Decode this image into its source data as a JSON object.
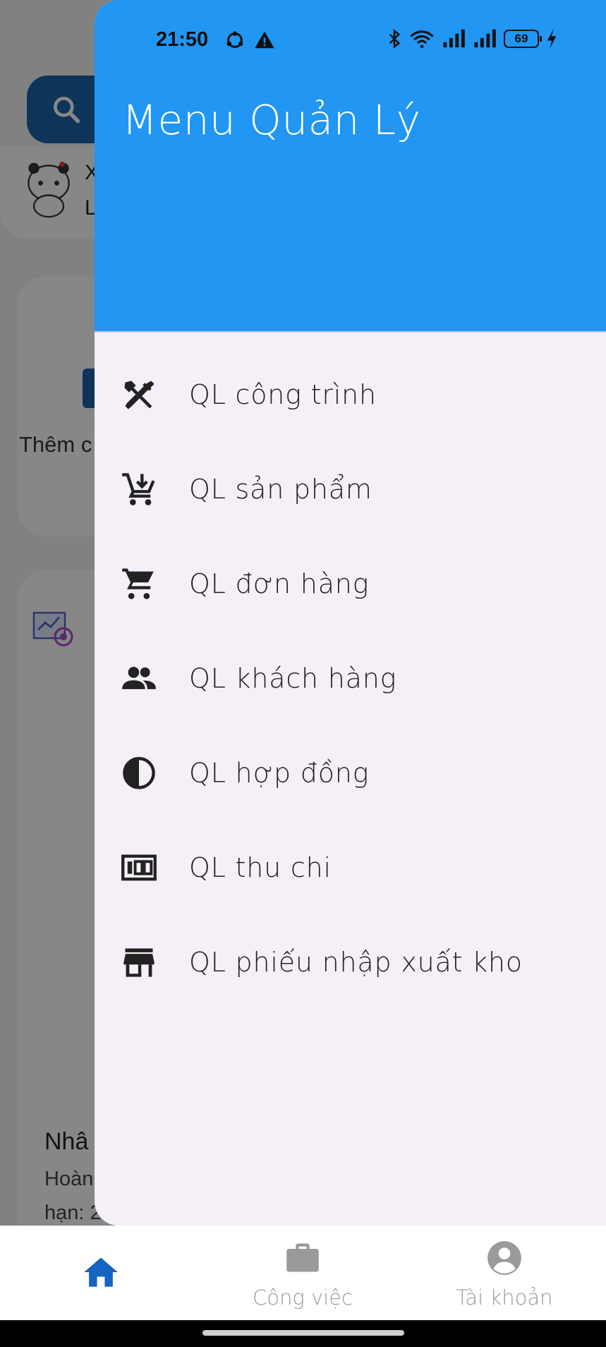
{
  "status_bar": {
    "time": "21:50",
    "battery_level": "69",
    "icons": [
      "sync-icon",
      "warning-icon",
      "bluetooth-icon",
      "wifi-icon",
      "signal-icon",
      "signal-icon",
      "battery-icon",
      "charging-icon"
    ]
  },
  "background": {
    "user_line_1": "X",
    "user_line_2": "L",
    "card1_text": "Thêm c",
    "card2_title": "Nhâ",
    "card2_line1": "Hoàn",
    "card2_line2": "hạn: 2"
  },
  "drawer": {
    "title": "Menu Quản Lý",
    "items": [
      {
        "label": "QL công trình",
        "icon": "tools-icon"
      },
      {
        "label": "QL sản phẩm",
        "icon": "add-shopping-cart-icon"
      },
      {
        "label": "QL đơn hàng",
        "icon": "shopping-cart-icon"
      },
      {
        "label": "QL khách hàng",
        "icon": "people-icon"
      },
      {
        "label": "QL hợp đồng",
        "icon": "contrast-icon"
      },
      {
        "label": "QL thu chi",
        "icon": "money-icon"
      },
      {
        "label": "QL phiếu nhập xuất kho",
        "icon": "store-icon"
      }
    ]
  },
  "bottom_nav": {
    "items": [
      {
        "label": "",
        "icon": "home-icon",
        "active": true
      },
      {
        "label": "Công việc",
        "icon": "briefcase-icon",
        "active": false
      },
      {
        "label": "Tài khoản",
        "icon": "account-icon",
        "active": false
      }
    ],
    "active_color": "#1565c0",
    "inactive_color": "#9a9a9a"
  },
  "colors": {
    "drawer_header": "#2196f3",
    "drawer_body": "#f5eff8",
    "accent": "#1c63a8"
  }
}
